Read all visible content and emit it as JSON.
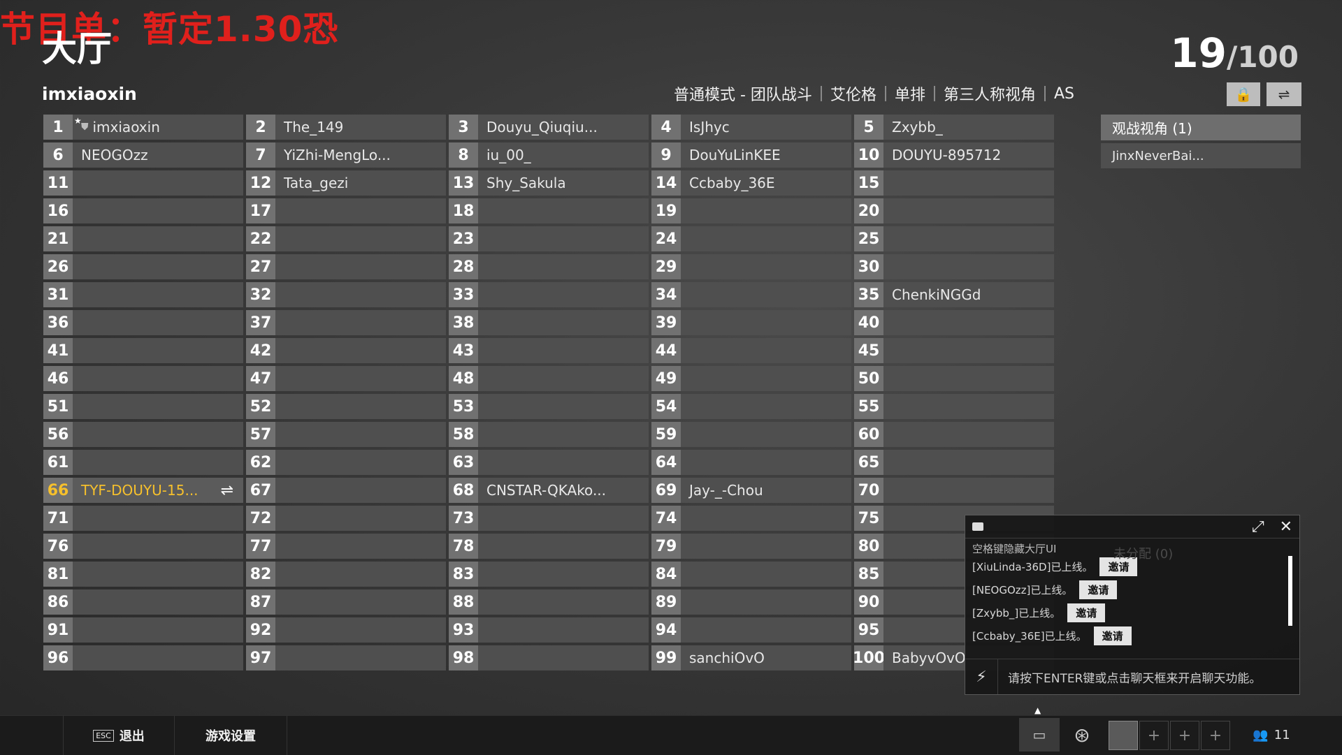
{
  "banner_text": "节目单：暂定1.30恐",
  "title": "大厅",
  "player_count": {
    "current": "19",
    "max": "/100"
  },
  "username": "imxiaoxin",
  "mode": [
    "普通模式 - 团队战斗",
    "艾伦格",
    "单排",
    "第三人称视角",
    "AS"
  ],
  "slots": [
    {
      "num": "1",
      "name": "imxiaoxin",
      "host": true
    },
    {
      "num": "2",
      "name": "The_149"
    },
    {
      "num": "3",
      "name": "Douyu_Qiuqiu..."
    },
    {
      "num": "4",
      "name": "IsJhyc"
    },
    {
      "num": "5",
      "name": "Zxybb_"
    },
    {
      "num": "6",
      "name": "NEOGOzz"
    },
    {
      "num": "7",
      "name": "YiZhi-MengLo..."
    },
    {
      "num": "8",
      "name": "iu_00_"
    },
    {
      "num": "9",
      "name": "DouYuLinKEE"
    },
    {
      "num": "10",
      "name": "DOUYU-895712"
    },
    {
      "num": "11",
      "name": ""
    },
    {
      "num": "12",
      "name": "Tata_gezi"
    },
    {
      "num": "13",
      "name": "Shy_Sakula"
    },
    {
      "num": "14",
      "name": "Ccbaby_36E"
    },
    {
      "num": "15",
      "name": ""
    },
    {
      "num": "16",
      "name": ""
    },
    {
      "num": "17",
      "name": ""
    },
    {
      "num": "18",
      "name": ""
    },
    {
      "num": "19",
      "name": ""
    },
    {
      "num": "20",
      "name": ""
    },
    {
      "num": "21",
      "name": ""
    },
    {
      "num": "22",
      "name": ""
    },
    {
      "num": "23",
      "name": ""
    },
    {
      "num": "24",
      "name": ""
    },
    {
      "num": "25",
      "name": ""
    },
    {
      "num": "26",
      "name": ""
    },
    {
      "num": "27",
      "name": ""
    },
    {
      "num": "28",
      "name": ""
    },
    {
      "num": "29",
      "name": ""
    },
    {
      "num": "30",
      "name": ""
    },
    {
      "num": "31",
      "name": ""
    },
    {
      "num": "32",
      "name": ""
    },
    {
      "num": "33",
      "name": ""
    },
    {
      "num": "34",
      "name": ""
    },
    {
      "num": "35",
      "name": "ChenkiNGGd"
    },
    {
      "num": "36",
      "name": ""
    },
    {
      "num": "37",
      "name": ""
    },
    {
      "num": "38",
      "name": ""
    },
    {
      "num": "39",
      "name": ""
    },
    {
      "num": "40",
      "name": ""
    },
    {
      "num": "41",
      "name": ""
    },
    {
      "num": "42",
      "name": ""
    },
    {
      "num": "43",
      "name": ""
    },
    {
      "num": "44",
      "name": ""
    },
    {
      "num": "45",
      "name": ""
    },
    {
      "num": "46",
      "name": ""
    },
    {
      "num": "47",
      "name": ""
    },
    {
      "num": "48",
      "name": ""
    },
    {
      "num": "49",
      "name": ""
    },
    {
      "num": "50",
      "name": ""
    },
    {
      "num": "51",
      "name": ""
    },
    {
      "num": "52",
      "name": ""
    },
    {
      "num": "53",
      "name": ""
    },
    {
      "num": "54",
      "name": ""
    },
    {
      "num": "55",
      "name": ""
    },
    {
      "num": "56",
      "name": ""
    },
    {
      "num": "57",
      "name": ""
    },
    {
      "num": "58",
      "name": ""
    },
    {
      "num": "59",
      "name": ""
    },
    {
      "num": "60",
      "name": ""
    },
    {
      "num": "61",
      "name": ""
    },
    {
      "num": "62",
      "name": ""
    },
    {
      "num": "63",
      "name": ""
    },
    {
      "num": "64",
      "name": ""
    },
    {
      "num": "65",
      "name": ""
    },
    {
      "num": "66",
      "name": "TYF-DOUYU-15...",
      "self": true
    },
    {
      "num": "67",
      "name": ""
    },
    {
      "num": "68",
      "name": "CNSTAR-QKAko..."
    },
    {
      "num": "69",
      "name": "Jay-_-Chou"
    },
    {
      "num": "70",
      "name": ""
    },
    {
      "num": "71",
      "name": ""
    },
    {
      "num": "72",
      "name": ""
    },
    {
      "num": "73",
      "name": ""
    },
    {
      "num": "74",
      "name": ""
    },
    {
      "num": "75",
      "name": ""
    },
    {
      "num": "76",
      "name": ""
    },
    {
      "num": "77",
      "name": ""
    },
    {
      "num": "78",
      "name": ""
    },
    {
      "num": "79",
      "name": ""
    },
    {
      "num": "80",
      "name": ""
    },
    {
      "num": "81",
      "name": ""
    },
    {
      "num": "82",
      "name": ""
    },
    {
      "num": "83",
      "name": ""
    },
    {
      "num": "84",
      "name": ""
    },
    {
      "num": "85",
      "name": ""
    },
    {
      "num": "86",
      "name": ""
    },
    {
      "num": "87",
      "name": ""
    },
    {
      "num": "88",
      "name": ""
    },
    {
      "num": "89",
      "name": ""
    },
    {
      "num": "90",
      "name": ""
    },
    {
      "num": "91",
      "name": ""
    },
    {
      "num": "92",
      "name": ""
    },
    {
      "num": "93",
      "name": ""
    },
    {
      "num": "94",
      "name": ""
    },
    {
      "num": "95",
      "name": ""
    },
    {
      "num": "96",
      "name": ""
    },
    {
      "num": "97",
      "name": ""
    },
    {
      "num": "98",
      "name": ""
    },
    {
      "num": "99",
      "name": "sanchiOvO"
    },
    {
      "num": "100",
      "name": "BabyvOvO"
    }
  ],
  "spectator": {
    "header": "观战视角 (1)",
    "members": [
      "JinxNeverBai..."
    ]
  },
  "chat": {
    "ghost_text": "未分配 (0)",
    "hint": "空格键隐藏大厅UI",
    "messages": [
      {
        "text": "[XiuLinda-36D]已上线。",
        "action": "邀请"
      },
      {
        "text": "[NEOGOzz]已上线。",
        "action": "邀请"
      },
      {
        "text": "[Zxybb_]已上线。",
        "action": "邀请"
      },
      {
        "text": "[Ccbaby_36E]已上线。",
        "action": "邀请"
      }
    ],
    "input_placeholder": "请按下ENTER键或点击聊天框来开启聊天功能。"
  },
  "bottom": {
    "esc_key": "ESC",
    "exit_label": "退出",
    "settings_label": "游戏设置",
    "friends_count": "11"
  },
  "colors": {
    "highlight": "#f6c02c",
    "banner": "#e0201c"
  }
}
